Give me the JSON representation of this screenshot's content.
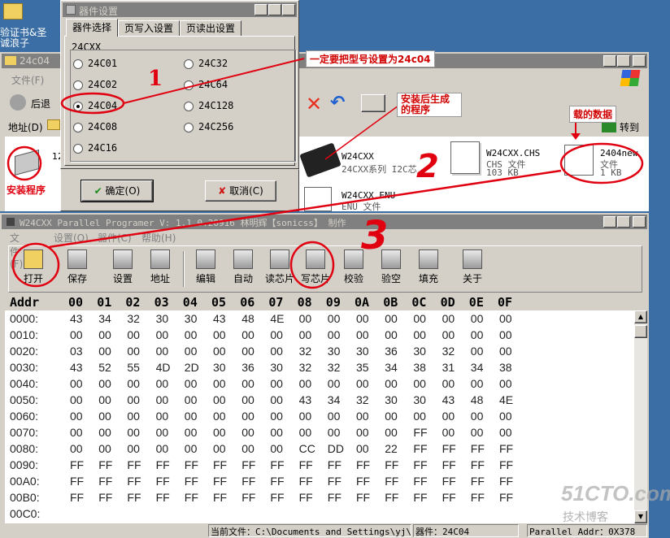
{
  "desktop": {
    "icon_label": "验证书&圣诚浪子"
  },
  "device_dialog": {
    "title": "器件设置",
    "tabs": [
      "器件选择",
      "页写入设置",
      "页读出设置"
    ],
    "group_label": "24CXX",
    "left_options": [
      "24C01",
      "24C02",
      "24C04",
      "24C08",
      "24C16"
    ],
    "right_options": [
      "24C32",
      "24C64",
      "24C128",
      "24C256"
    ],
    "selected": "24C04",
    "ok_label": "确定(O)",
    "cancel_label": "取消(C)"
  },
  "explorer": {
    "title": "24c04",
    "menu_file": "文件(F)",
    "back_label": "后退",
    "address_label": "地址(D)",
    "go_label": "转到",
    "left_icon_label": "12",
    "files": [
      {
        "name": "W24CXX",
        "desc": "24CXX系列 I2C芯"
      },
      {
        "name": "W24CXX.CHS",
        "desc": "CHS 文件",
        "size": "103 KB"
      },
      {
        "name": "2404new",
        "desc": "文件",
        "size": "1 KB"
      },
      {
        "name": "W24CXX.ENU",
        "desc": "ENU 文件"
      }
    ]
  },
  "annotations": {
    "set_model": "一定要把型号设置为24c04",
    "after_install": "安装后生成的程序",
    "data_label": "载的数据",
    "install_prog": "安装程序",
    "num1": "1",
    "num2": "2",
    "num3": "3"
  },
  "app": {
    "title": "W24CXX Parallel Programer  V: 1.1.0.20916  林明辉【sonicss】 制作",
    "menu": [
      "文件(F)",
      "设置(O)",
      "器件(C)",
      "帮助(H)"
    ],
    "toolbar": [
      "打开",
      "保存",
      "设置",
      "地址",
      "编辑",
      "自动",
      "读芯片",
      "写芯片",
      "校验",
      "验空",
      "填充",
      "关于"
    ],
    "hex_header": {
      "addr": "Addr",
      "cols": [
        "00",
        "01",
        "02",
        "03",
        "04",
        "05",
        "06",
        "07",
        "08",
        "09",
        "0A",
        "0B",
        "0C",
        "0D",
        "0E",
        "0F"
      ]
    },
    "hex_rows": [
      {
        "addr": "0000:",
        "bytes": [
          "43",
          "34",
          "32",
          "30",
          "30",
          "43",
          "48",
          "4E",
          "00",
          "00",
          "00",
          "00",
          "00",
          "00",
          "00",
          "00"
        ]
      },
      {
        "addr": "0010:",
        "bytes": [
          "00",
          "00",
          "00",
          "00",
          "00",
          "00",
          "00",
          "00",
          "00",
          "00",
          "00",
          "00",
          "00",
          "00",
          "00",
          "00"
        ]
      },
      {
        "addr": "0020:",
        "bytes": [
          "03",
          "00",
          "00",
          "00",
          "00",
          "00",
          "00",
          "00",
          "32",
          "30",
          "30",
          "36",
          "30",
          "32",
          "00",
          "00"
        ]
      },
      {
        "addr": "0030:",
        "bytes": [
          "43",
          "52",
          "55",
          "4D",
          "2D",
          "30",
          "36",
          "30",
          "32",
          "32",
          "35",
          "34",
          "38",
          "31",
          "34",
          "38"
        ]
      },
      {
        "addr": "0040:",
        "bytes": [
          "00",
          "00",
          "00",
          "00",
          "00",
          "00",
          "00",
          "00",
          "00",
          "00",
          "00",
          "00",
          "00",
          "00",
          "00",
          "00"
        ]
      },
      {
        "addr": "0050:",
        "bytes": [
          "00",
          "00",
          "00",
          "00",
          "00",
          "00",
          "00",
          "00",
          "43",
          "34",
          "32",
          "30",
          "30",
          "43",
          "48",
          "4E"
        ]
      },
      {
        "addr": "0060:",
        "bytes": [
          "00",
          "00",
          "00",
          "00",
          "00",
          "00",
          "00",
          "00",
          "00",
          "00",
          "00",
          "00",
          "00",
          "00",
          "00",
          "00"
        ]
      },
      {
        "addr": "0070:",
        "bytes": [
          "00",
          "00",
          "00",
          "00",
          "00",
          "00",
          "00",
          "00",
          "00",
          "00",
          "00",
          "00",
          "FF",
          "00",
          "00",
          "00"
        ]
      },
      {
        "addr": "0080:",
        "bytes": [
          "00",
          "00",
          "00",
          "00",
          "00",
          "00",
          "00",
          "00",
          "CC",
          "DD",
          "00",
          "22",
          "FF",
          "FF",
          "FF",
          "FF"
        ]
      },
      {
        "addr": "0090:",
        "bytes": [
          "FF",
          "FF",
          "FF",
          "FF",
          "FF",
          "FF",
          "FF",
          "FF",
          "FF",
          "FF",
          "FF",
          "FF",
          "FF",
          "FF",
          "FF",
          "FF"
        ]
      },
      {
        "addr": "00A0:",
        "bytes": [
          "FF",
          "FF",
          "FF",
          "FF",
          "FF",
          "FF",
          "FF",
          "FF",
          "FF",
          "FF",
          "FF",
          "FF",
          "FF",
          "FF",
          "FF",
          "FF"
        ]
      },
      {
        "addr": "00B0:",
        "bytes": [
          "FF",
          "FF",
          "FF",
          "FF",
          "FF",
          "FF",
          "FF",
          "FF",
          "FF",
          "FF",
          "FF",
          "FF",
          "FF",
          "FF",
          "FF",
          "FF"
        ]
      },
      {
        "addr": "00C0:",
        "bytes": []
      }
    ],
    "status": {
      "current_file": "当前文件：C:\\Documents and Settings\\yj\\桌",
      "device": "器件：24C04",
      "parallel": "Parallel Addr：0X378"
    }
  },
  "watermark": {
    "site": "51CTO.com",
    "sub": "技术博客"
  }
}
